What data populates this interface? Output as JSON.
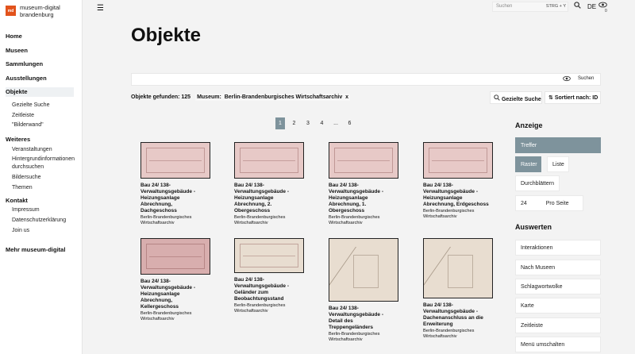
{
  "brand": {
    "logo": "md",
    "line1": "museum-digital",
    "line2": "brandenburg"
  },
  "nav": {
    "home": "Home",
    "museen": "Museen",
    "sammlungen": "Sammlungen",
    "ausstellungen": "Ausstellungen",
    "objekte": "Objekte",
    "objekte_sub": [
      "Gezielte Suche",
      "Zeitleiste",
      "\"Bilderwand\""
    ],
    "weiteres": "Weiteres",
    "weiteres_sub": [
      "Veranstaltungen",
      "Hintergrundinformationen durchsuchen",
      "Bildersuche",
      "Themen"
    ],
    "kontakt": "Kontakt",
    "kontakt_sub": [
      "Impressum",
      "Datenschutzerklärung",
      "Join us"
    ],
    "mehr": "Mehr museum-digital"
  },
  "topbar": {
    "menu_icon": "hamburger-icon",
    "search_placeholder": "Suchen",
    "shortcut": "STRG + Y",
    "lang": "DE",
    "badge": "0"
  },
  "main": {
    "title": "Objekte",
    "search_button": "Suchen",
    "results_label": "Objekte gefunden: 125",
    "filter_label": "Museum:",
    "filter_value": "Berlin-Brandenburgisches Wirtschaftsarchiv",
    "filter_remove": "x",
    "targeted_search": "Gezielte Suche",
    "sort": "Sortiert nach: ID",
    "pages": [
      "1",
      "2",
      "3",
      "4",
      "...",
      "6"
    ]
  },
  "objects": [
    {
      "title": "Bau 24/ 138- Verwaltungsgebäude - Heizungsanlage Abrechnung, Dachgeschoss",
      "inst": "Berlin-Brandenburgisches Wirtschaftsarchiv"
    },
    {
      "title": "Bau 24/ 138- Verwaltungsgebäude - Heizungsanlage Abrechnung, 2. Obergeschoss",
      "inst": "Berlin-Brandenburgisches Wirtschaftsarchiv"
    },
    {
      "title": "Bau 24/ 138- Verwaltungsgebäude - Heizungsanlage Abrechnung, 1. Obergeschoss",
      "inst": "Berlin-Brandenburgisches Wirtschaftsarchiv"
    },
    {
      "title": "Bau 24/ 138- Verwaltungsgebäude - Heizungsanlage Abrechnung, Erdgeschoss",
      "inst": "Berlin-Brandenburgisches Wirtschaftsarchiv"
    },
    {
      "title": "Bau 24/ 138- Verwaltungsgebäude - Heizungsanlage Abrechnung, Kellergeschoss",
      "inst": "Berlin-Brandenburgisches Wirtschaftsarchiv"
    },
    {
      "title": "Bau 24/ 138- Verwaltungsgebäude - Geländer zum Beobachtungsstand",
      "inst": "Berlin-Brandenburgisches Wirtschaftsarchiv"
    },
    {
      "title": "Bau 24/ 138- Verwaltungsgebäude - Detail des Treppengeländers",
      "inst": "Berlin-Brandenburgisches Wirtschaftsarchiv"
    },
    {
      "title": "Bau 24/ 138- Verwaltungsgebäude - Dachenanschluss an die Erweiterung",
      "inst": "Berlin-Brandenburgisches Wirtschaftsarchiv"
    }
  ],
  "panel": {
    "anzeige": "Anzeige",
    "treffer": "Treffer",
    "raster": "Raster",
    "liste": "Liste",
    "durchblaettern": "Durchblättern",
    "per_page_value": "24",
    "per_page_label": "Pro Seite",
    "auswerten": "Auswerten",
    "items": [
      "Interaktionen",
      "Nach Museen",
      "Schlagwortwolke",
      "Karte",
      "Zeitleiste",
      "Menü umschalten"
    ]
  },
  "colors": {
    "accent": "#7e939c",
    "logo": "#e2531c"
  }
}
